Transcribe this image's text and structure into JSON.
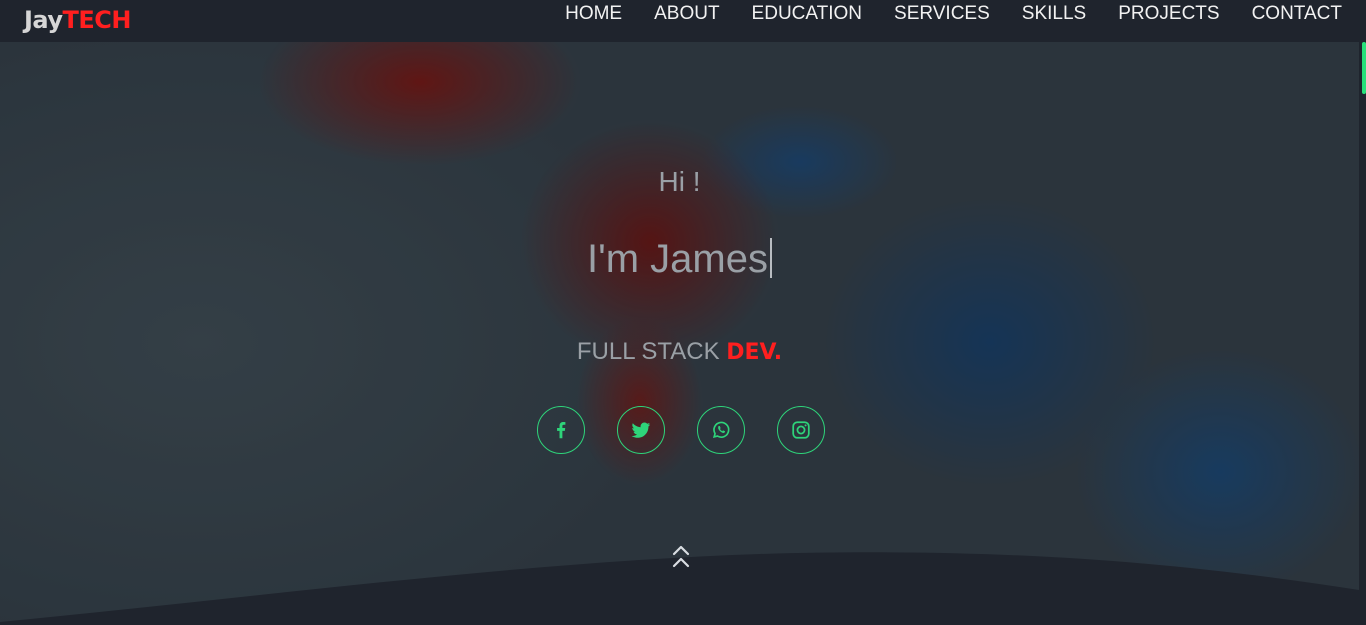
{
  "brand": {
    "part1": "Jay",
    "part2": "TECH",
    "accent_color": "#ff1f1f"
  },
  "nav": {
    "items": [
      {
        "label": "HOME"
      },
      {
        "label": "ABOUT"
      },
      {
        "label": "EDUCATION"
      },
      {
        "label": "SERVICES"
      },
      {
        "label": "SKILLS"
      },
      {
        "label": "PROJECTS"
      },
      {
        "label": "CONTACT"
      }
    ]
  },
  "hero": {
    "greeting": "Hi !",
    "intro": "I'm James",
    "role_main": "FULL STACK",
    "role_accent": "DEV."
  },
  "socials": [
    {
      "icon": "facebook-icon"
    },
    {
      "icon": "twitter-icon"
    },
    {
      "icon": "whatsapp-icon"
    },
    {
      "icon": "instagram-icon"
    }
  ],
  "scroll_up": {
    "icon": "double-chevron-up-icon"
  },
  "theme": {
    "social_color": "#2ed47a",
    "scroll_thumb_color": "#28e07a",
    "background": "#1f242d"
  }
}
